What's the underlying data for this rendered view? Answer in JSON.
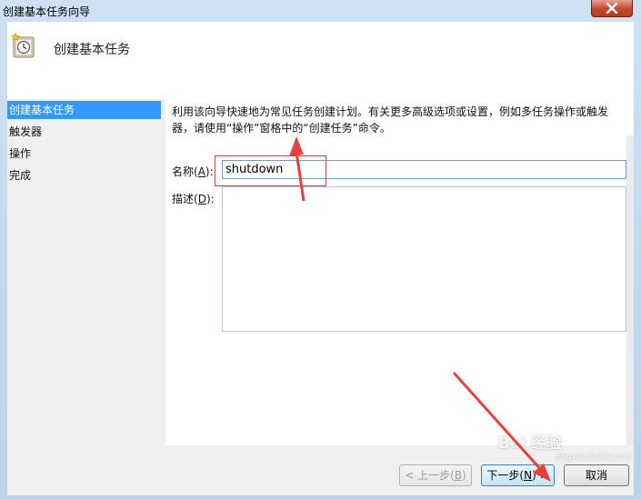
{
  "window": {
    "title": "创建基本任务向导"
  },
  "header": {
    "title": "创建基本任务"
  },
  "sidebar": {
    "items": [
      {
        "label": "创建基本任务"
      },
      {
        "label": "触发器"
      },
      {
        "label": "操作"
      },
      {
        "label": "完成"
      }
    ]
  },
  "content": {
    "description": "利用该向导快速地为常见任务创建计划。有关更多高级选项或设置，例如多任务操作或触发器，请使用“操作”窗格中的“创建任务”命令。",
    "name_label": "名称",
    "name_hotkey": "A",
    "name_value": "shutdown",
    "desc_label": "描述",
    "desc_hotkey": "D",
    "desc_value": ""
  },
  "footer": {
    "prev": {
      "label": "< 上一步",
      "hotkey": "B"
    },
    "next": {
      "label": "下一步",
      "hotkey": "N",
      "suffix": " >"
    },
    "cancel": {
      "label": "取消"
    }
  },
  "watermark": {
    "text": "Bai 经验",
    "sub": "jingyan.baidu.com"
  },
  "colors": {
    "selection": "#3399ff",
    "annotation": "#e23a3a"
  }
}
